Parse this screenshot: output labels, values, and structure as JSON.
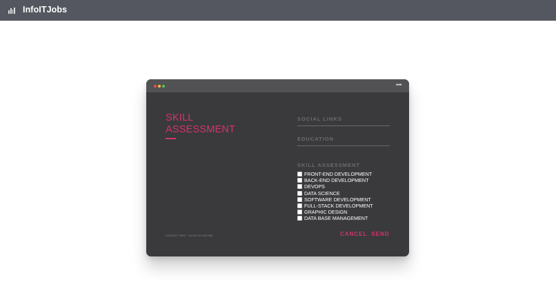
{
  "app": {
    "brand": "InfoITJobs",
    "logo_icon": "bar-chart-icon"
  },
  "window": {
    "more_icon": "more-horizontal-icon",
    "more_glyph": "•••",
    "traffic_lights": [
      "#e8515d",
      "#f1c23b",
      "#5fc35a"
    ]
  },
  "form": {
    "title": "Skill Assessment",
    "contact": "CONTACT INFO : +62 81 314 928 595",
    "social_label": "Social Links",
    "education_label": "Education",
    "skills_heading": "Skill Assessment",
    "skills": [
      {
        "label": "Front-End Development",
        "checked": false
      },
      {
        "label": "Back-End Development",
        "checked": false
      },
      {
        "label": "DevOps",
        "checked": false
      },
      {
        "label": "Data Science",
        "checked": false
      },
      {
        "label": "Software Development",
        "checked": false
      },
      {
        "label": "Full-Stack Development",
        "checked": false
      },
      {
        "label": "Graphic Design",
        "checked": false
      },
      {
        "label": "Data Base Management",
        "checked": false
      }
    ],
    "cancel_label": "Cancel",
    "send_label": "Send"
  },
  "colors": {
    "topbar": "#54575f",
    "card": "#3a3a3c",
    "accent": "#d4336a"
  }
}
